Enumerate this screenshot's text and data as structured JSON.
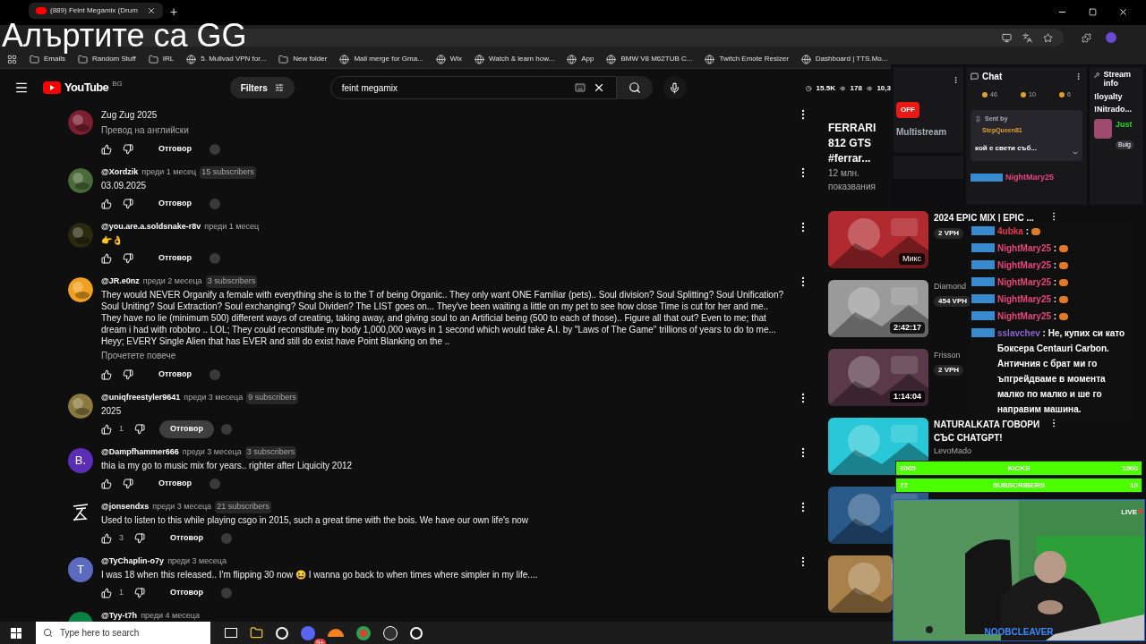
{
  "browser": {
    "tab_title": "(889) Feint Megamix (Drum",
    "new_tab": "+",
    "bookmarks": [
      {
        "label": "Emails",
        "kind": "folder"
      },
      {
        "label": "Random Stuff",
        "kind": "folder"
      },
      {
        "label": "IRL",
        "kind": "folder"
      },
      {
        "label": "5. Mullvad VPN for...",
        "kind": "site"
      },
      {
        "label": "New folder",
        "kind": "folder"
      },
      {
        "label": "Mail merge for Gma...",
        "kind": "site"
      },
      {
        "label": "Wix",
        "kind": "site"
      },
      {
        "label": "Watch & learn how...",
        "kind": "site"
      },
      {
        "label": "App",
        "kind": "site"
      },
      {
        "label": "BMW V8 M62TUB C...",
        "kind": "site"
      },
      {
        "label": "Twitch Emote Resizer",
        "kind": "site"
      },
      {
        "label": "Dashboard | TTS.Mo...",
        "kind": "site"
      }
    ]
  },
  "overlay_title": "Алъртите са GG",
  "youtube": {
    "logo": "YouTube",
    "region": "BG",
    "filters": "Filters",
    "search_value": "feint megamix"
  },
  "comments": [
    {
      "text": "Zug Zug 2025",
      "translate": "Превод на английски",
      "reply": "Отговор",
      "hovered": false
    },
    {
      "author": "@Xordzik",
      "time": "преди 1 месец",
      "subs": "15 subscribers",
      "text": "03.09.2025",
      "reply": "Отговор",
      "hovered": false
    },
    {
      "author": "@you.are.a.soldsnake-r8v",
      "time": "преди 1 месец",
      "text": "👉👌",
      "reply": "Отговор",
      "hovered": false
    },
    {
      "author": "@JR.e0nz",
      "time": "преди 2 месеца",
      "subs": "3 subscribers",
      "text": "They would NEVER Organify a female with everything she is to the T of being Organic.. They only want ONE Familiar (pets).. Soul division? Soul Splitting? Soul Unification? Soul Uniting? Soul Extraction? Soul exchanging? Soul Dividen? The LIST goes on... They've been waiting a little on my pet to see how close Time is cut for her and me.. They have no lie (minimum 500) different ways of creating, taking away, and giving soul to an Artificial being (500 to each of those).. Figure all that out? Even to me; that dream i had with robobro .. LOL; They could reconstitute my body 1,000,000 ways in 1 second which would take A.I. by \"Laws of The Game\" trillions of years to do to me... Heyy; EVERY Single Alien that has EVER and still do exist have Point Blanking on the ..",
      "more": "Прочетете повече",
      "reply": "Отговор",
      "hovered": false
    },
    {
      "author": "@uniqfreestyler9641",
      "time": "преди 3 месеца",
      "subs": "9 subscribers",
      "text": "2025",
      "likes": "1",
      "reply": "Отговор",
      "hovered": true
    },
    {
      "author": "@Dampfhammer666",
      "time": "преди 3 месеца",
      "subs": "3 subscribers",
      "text": "thia ia my go to music mix for years.. righter after Liquicity 2012",
      "reply": "Отговор",
      "hovered": false,
      "avatar": {
        "kind": "letter",
        "letter": "B.",
        "color": "#5b2fb5"
      }
    },
    {
      "author": "@jonsendxs",
      "time": "преди 3 месеца",
      "subs": "21 subscribers",
      "text": "Used to listen to this while playing csgo in 2015, such a great time with the bois. We have our own life's now",
      "likes": "3",
      "reply": "Отговор",
      "hovered": false,
      "avatar": {
        "kind": "glyph"
      }
    },
    {
      "author": "@TyChaplin-o7y",
      "time": "преди 3 месеца",
      "text": "I was 18 when this released.. I'm flipping 30 now 😆  I wanna go back to when times where simpler in my life....",
      "likes": "1",
      "reply": "Отговор",
      "hovered": false,
      "avatar": {
        "kind": "letter",
        "letter": "T",
        "color": "#5c6bc0"
      }
    },
    {
      "author": "@Tyy-t7h",
      "time": "преди 4 месеца",
      "avatar": {
        "kind": "letter",
        "color": "#0b8043"
      }
    }
  ],
  "sidebar": [
    {
      "kind": "text",
      "title": "FERRARI 812 GTS #ferrar...",
      "meta": [
        "12 млн.",
        "показвания"
      ]
    },
    {
      "kind": "video",
      "title": "2024 EPIC MIX | EPIC ...",
      "badge": "Микс",
      "vph": "2 VPH"
    },
    {
      "kind": "video",
      "duration": "2:42:17",
      "channel": "Diamond",
      "vph": "454 VPH"
    },
    {
      "kind": "video",
      "duration": "1:14:04",
      "channel": "Frisson",
      "vph": "2 VPH"
    },
    {
      "kind": "video",
      "title": "NATURALKATA ГОВОРИ СЪС CHATGPT!",
      "channel": "LevoMado"
    },
    {
      "kind": "video"
    },
    {
      "kind": "video"
    }
  ],
  "dashboard": {
    "stats": [
      "15.5K",
      "178",
      "10,3"
    ],
    "multistream_state": "OFF",
    "multistream": "Multistream",
    "chat_title": "Chat",
    "counts": [
      "46",
      "10",
      "6"
    ],
    "pinned": {
      "label": "Sent by",
      "user": "StepQueen81",
      "text": "кой е свети съб..."
    },
    "first_message": {
      "user": "NightMary25",
      "color": "#e8457a"
    },
    "stream_info": {
      "title": "Stream info",
      "lines": [
        "!loyalty",
        "!Nitrado..."
      ],
      "status": "Just",
      "tag": "Bulg"
    }
  },
  "chat": [
    {
      "user": "4ubka",
      "color": "#e33b4a",
      "text": ":",
      "kind": "emote"
    },
    {
      "user": "NightMary25",
      "color": "#e8457a",
      "text": ":",
      "kind": "emote"
    },
    {
      "user": "NightMary25",
      "color": "#e8457a",
      "text": ":",
      "kind": "emote"
    },
    {
      "user": "NightMary25",
      "color": "#e8457a",
      "text": ":",
      "kind": "emote"
    },
    {
      "user": "NightMary25",
      "color": "#e8457a",
      "text": ":",
      "kind": "emote"
    },
    {
      "user": "NightMary25",
      "color": "#e8457a",
      "text": ":",
      "kind": "emote"
    },
    {
      "user": "sslavchev",
      "color": "#8a63d2",
      "kind": "text",
      "text": ": Не, купих си като Боксера Centauri Carbon. Античния с брат ми го ъпгрейдваме в момента малко по малко и ше го направим машина."
    }
  ],
  "goals": [
    {
      "current": "3005",
      "label": "KICKS",
      "target": "1000"
    },
    {
      "current": "72",
      "label": "SUBSCRIBERS",
      "target": "10"
    }
  ],
  "webcam": {
    "live": "LIVE",
    "name": "NOOBCLEAVER"
  },
  "taskbar": {
    "search_placeholder": "Type here to search",
    "badge": "9+"
  }
}
